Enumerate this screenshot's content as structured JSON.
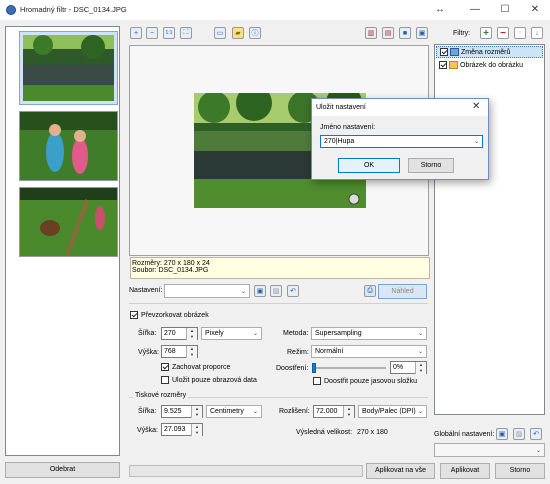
{
  "window": {
    "title": "Hromadný filtr - DSC_0134.JPG",
    "controls": [
      "↔",
      "—",
      "☐",
      "✕"
    ]
  },
  "toolbar": {
    "icons": [
      "zoom-in-icon",
      "zoom-out-icon",
      "actual-size-icon",
      "fit-icon",
      "image-icon",
      "folder-icon",
      "info-icon"
    ],
    "view_icons": [
      "split-view-icon",
      "compare-view-icon",
      "single-view-icon",
      "preview-view-icon"
    ]
  },
  "filters": {
    "label": "Filtry:",
    "items": [
      {
        "label": "Změna rozměrů",
        "checked": true,
        "selected": true
      },
      {
        "label": "Obrázek do obrázku",
        "checked": true,
        "selected": false
      }
    ]
  },
  "preview": {
    "info_line1": "Rozměry: 270 x 180 x 24",
    "info_line2": "Soubor: DSC_0134.JPG"
  },
  "settings": {
    "label": "Nastavení:",
    "value": "",
    "preview_button": "Náhled"
  },
  "resample": {
    "label": "Převzorkovat obrázek",
    "checked": true,
    "width_label": "Šířka:",
    "width_value": "270",
    "unit": "Pixely",
    "height_label": "Výška:",
    "height_value": "768",
    "keep_ratio_label": "Zachovat proporce",
    "keep_ratio_checked": true,
    "save_only_label": "Uložit pouze obrazová data",
    "save_only_checked": false,
    "method_label": "Metoda:",
    "method_value": "Supersampling",
    "mode_label": "Režim:",
    "mode_value": "Normální",
    "sharpen_label": "Doostření:",
    "sharpen_value": "0%",
    "sharpen_level": 0,
    "sharpen_luma_label": "Doostřit pouze jasovou složku",
    "sharpen_luma_checked": false
  },
  "print": {
    "label": "Tiskové rozměry",
    "width_label": "Šířka:",
    "width_value": "9.525",
    "unit": "Centimetry",
    "height_label": "Výška:",
    "height_value": "27.093",
    "resolution_label": "Rozlišení:",
    "resolution_value": "72.000",
    "resolution_unit": "Body/Palec (DPI)",
    "result_label": "Výsledná velikost:",
    "result_value": "270 x 180"
  },
  "global": {
    "label": "Globální nastavení:",
    "value": ""
  },
  "footer": {
    "remove": "Odebrat",
    "apply_all": "Aplikovat na vše",
    "apply": "Aplikovat",
    "cancel": "Storno"
  },
  "dialog": {
    "title": "Uložit nastavení",
    "name_label": "Jméno nastavení:",
    "name_value": "270|Hupa",
    "ok": "OK",
    "cancel": "Storno"
  }
}
